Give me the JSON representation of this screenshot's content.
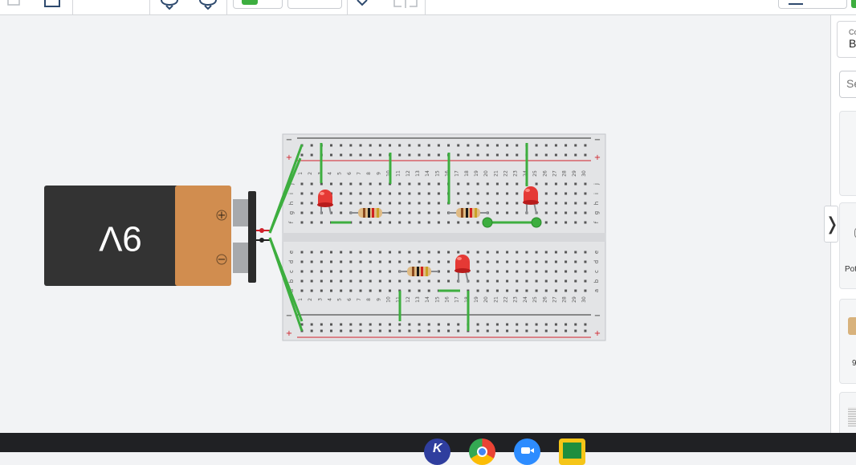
{
  "sidebar": {
    "components_label": "Co",
    "components_value": "B",
    "search_placeholder": "Se",
    "potentiometer_label": "Pot",
    "resistor_card_label": "9",
    "toggle_glyph": "❭"
  },
  "canvas": {
    "battery_label": "9V",
    "battery_plus": "+",
    "battery_minus": "−",
    "rail_minus": "−",
    "rail_plus": "+",
    "row_letters_top": [
      "j",
      "i",
      "h",
      "g",
      "f"
    ],
    "row_letters_bottom": [
      "e",
      "d",
      "c",
      "b",
      "a"
    ],
    "column_numbers": [
      "1",
      "2",
      "3",
      "4",
      "5",
      "6",
      "7",
      "8",
      "9",
      "10",
      "11",
      "12",
      "13",
      "14",
      "15",
      "16",
      "17",
      "18",
      "19",
      "20",
      "21",
      "22",
      "23",
      "24",
      "25",
      "26",
      "27",
      "28",
      "29",
      "30"
    ]
  },
  "colors": {
    "wire": "#3dae3f",
    "led": "#e53935",
    "battery_body": "#333333",
    "battery_cap": "#d18d4f",
    "rail_red": "#d0202a"
  },
  "taskbar": {
    "apps": [
      "k-icon",
      "chrome-icon",
      "zoom-icon",
      "classroom-icon"
    ]
  }
}
